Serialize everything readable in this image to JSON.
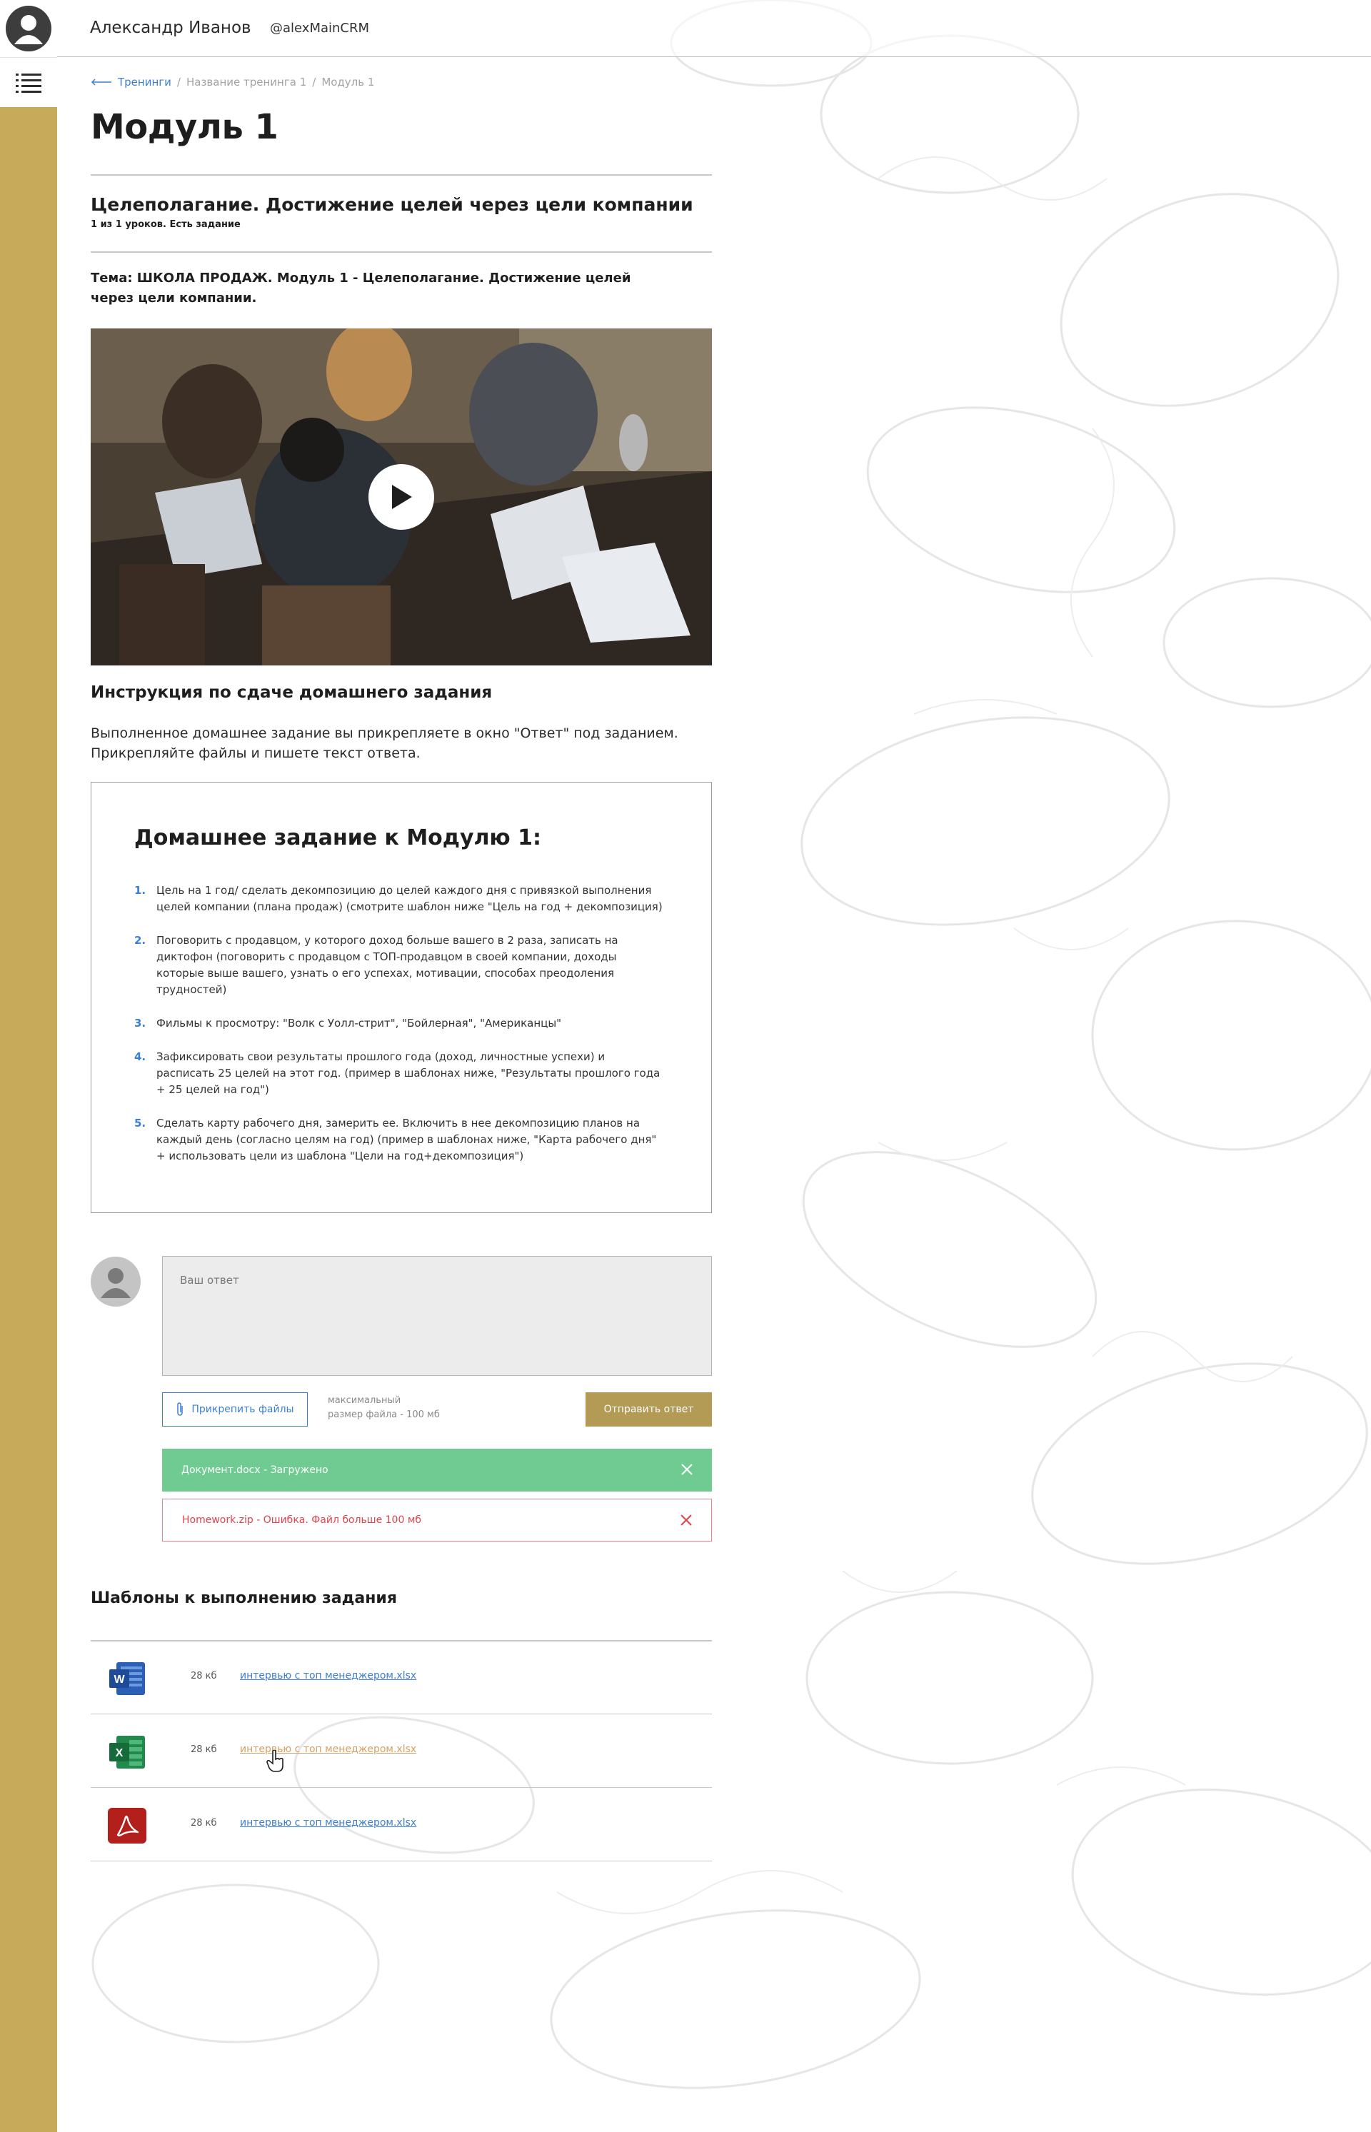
{
  "header": {
    "user_name": "Александр Иванов",
    "user_handle": "@alexMainCRM"
  },
  "sidebar": {
    "avatar_icon": "user-avatar-icon",
    "menu_icon": "list-menu-icon",
    "accent_color": "#c7ab5a"
  },
  "breadcrumb": {
    "back_label": "Тренинги",
    "items": [
      "Название тренинга 1",
      "Модуль 1"
    ],
    "separator": "/"
  },
  "page": {
    "title": "Модуль 1"
  },
  "lesson": {
    "title": "Целеполагание. Достижение целей через цели компании",
    "meta": "1 из 1 уроков. Есть задание",
    "topic": "Тема: ШКОЛА ПРОДАЖ. Модуль 1 - Целеполагание. Достижение целей через цели компании."
  },
  "video": {
    "play_icon": "play-icon"
  },
  "instructions": {
    "title": "Инструкция по сдаче домашнего задания",
    "text": "Выполненное домашнее задание вы прикрепляете в окно \"Ответ\" под заданием. Прикрепляйте файлы и пишете текст ответа."
  },
  "homework": {
    "title": "Домашнее задание к Модулю 1:",
    "items": [
      {
        "num": "1.",
        "text": "Цель на 1 год/ сделать декомпозицию до целей каждого дня с привязкой выполнения целей компании (плана продаж) (смотрите шаблон ниже \"Цель на год + декомпозиция)"
      },
      {
        "num": "2.",
        "text": "Поговорить с продавцом, у которого доход больше вашего в 2 раза, записать на диктофон (поговорить с продавцом с ТОП-продавцом в своей компании, доходы которые выше вашего, узнать о его успехах, мотивации, способах преодоления трудностей)"
      },
      {
        "num": "3.",
        "text": "Фильмы к просмотру: \"Волк с Уолл-стрит\", \"Бойлерная\", \"Американцы\""
      },
      {
        "num": "4.",
        "text": "Зафиксировать свои результаты прошлого года (доход, личностные успехи) и расписать 25 целей на этот год. (пример в шаблонах ниже, \"Результаты прошлого года + 25 целей на год\")"
      },
      {
        "num": "5.",
        "text": "Сделать карту рабочего дня, замерить ее. Включить в нее декомпозицию планов на каждый день (согласно целям на год) (пример в шаблонах ниже, \"Карта рабочего дня\" + использовать цели из шаблона \"Цели на год+декомпозиция\")"
      }
    ]
  },
  "answer": {
    "placeholder": "Ваш ответ",
    "attach_label": "Прикрепить файлы",
    "size_hint_line1": "максимальный",
    "size_hint_line2": "размер файла - 100 мб",
    "send_label": "Отправить ответ",
    "send_color": "#b39a55"
  },
  "uploads": [
    {
      "text": "Документ.docx - Загружено",
      "status": "success",
      "color": "#6fcb92"
    },
    {
      "text": "Homework.zip - Ошибка. Файл больше 100 мб",
      "status": "error",
      "color": "#e0434b"
    }
  ],
  "templates": {
    "title": "Шаблоны к выполнению задания",
    "items": [
      {
        "icon": "word-icon",
        "size": "28 кб",
        "name": "интервью с топ менеджером.xlsx"
      },
      {
        "icon": "excel-icon",
        "size": "28 кб",
        "name": "интервью с топ менеджером.xlsx",
        "hovered": true
      },
      {
        "icon": "pdf-icon",
        "size": "28 кб",
        "name": "интервью с топ менеджером.xlsx"
      }
    ]
  }
}
